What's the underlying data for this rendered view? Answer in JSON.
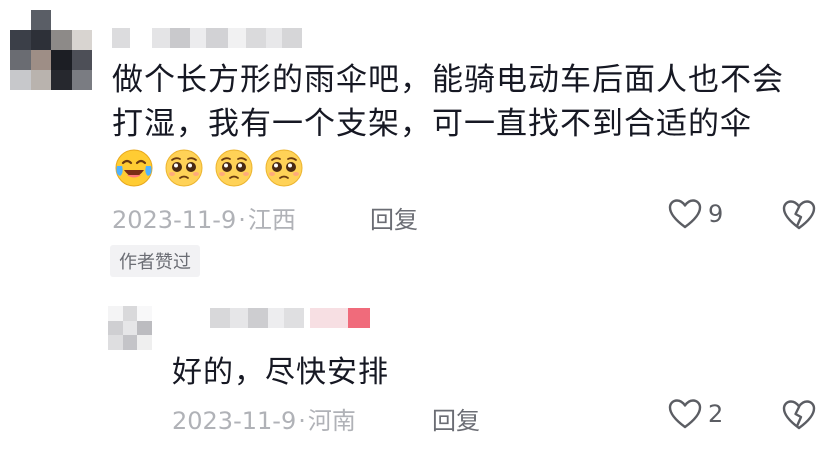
{
  "comments": [
    {
      "text": "做个长方形的雨伞吧，能骑电动车后面人也不会打湿，我有一个支架，可一直找不到合适的伞",
      "emojis": [
        "laughing-crying-emoji",
        "pleading-face-emoji",
        "pleading-face-emoji",
        "pleading-face-emoji"
      ],
      "date": "2023-11-9",
      "separator": "·",
      "location": "江西",
      "reply_label": "回复",
      "like_count": "9",
      "badge": "作者赞过"
    },
    {
      "text": "好的，尽快安排",
      "date": "2023-11-9",
      "separator": "·",
      "location": "河南",
      "reply_label": "回复",
      "like_count": "2"
    }
  ],
  "colors": {
    "text": "#161823",
    "meta": "#b0b2b7",
    "reply": "#6b6d74",
    "icon": "#5b5d63",
    "badge_bg": "#f2f2f4",
    "author_tag": "#f06b7b"
  },
  "icons": {
    "like": "heart-outline-icon",
    "dislike": "broken-heart-icon"
  }
}
